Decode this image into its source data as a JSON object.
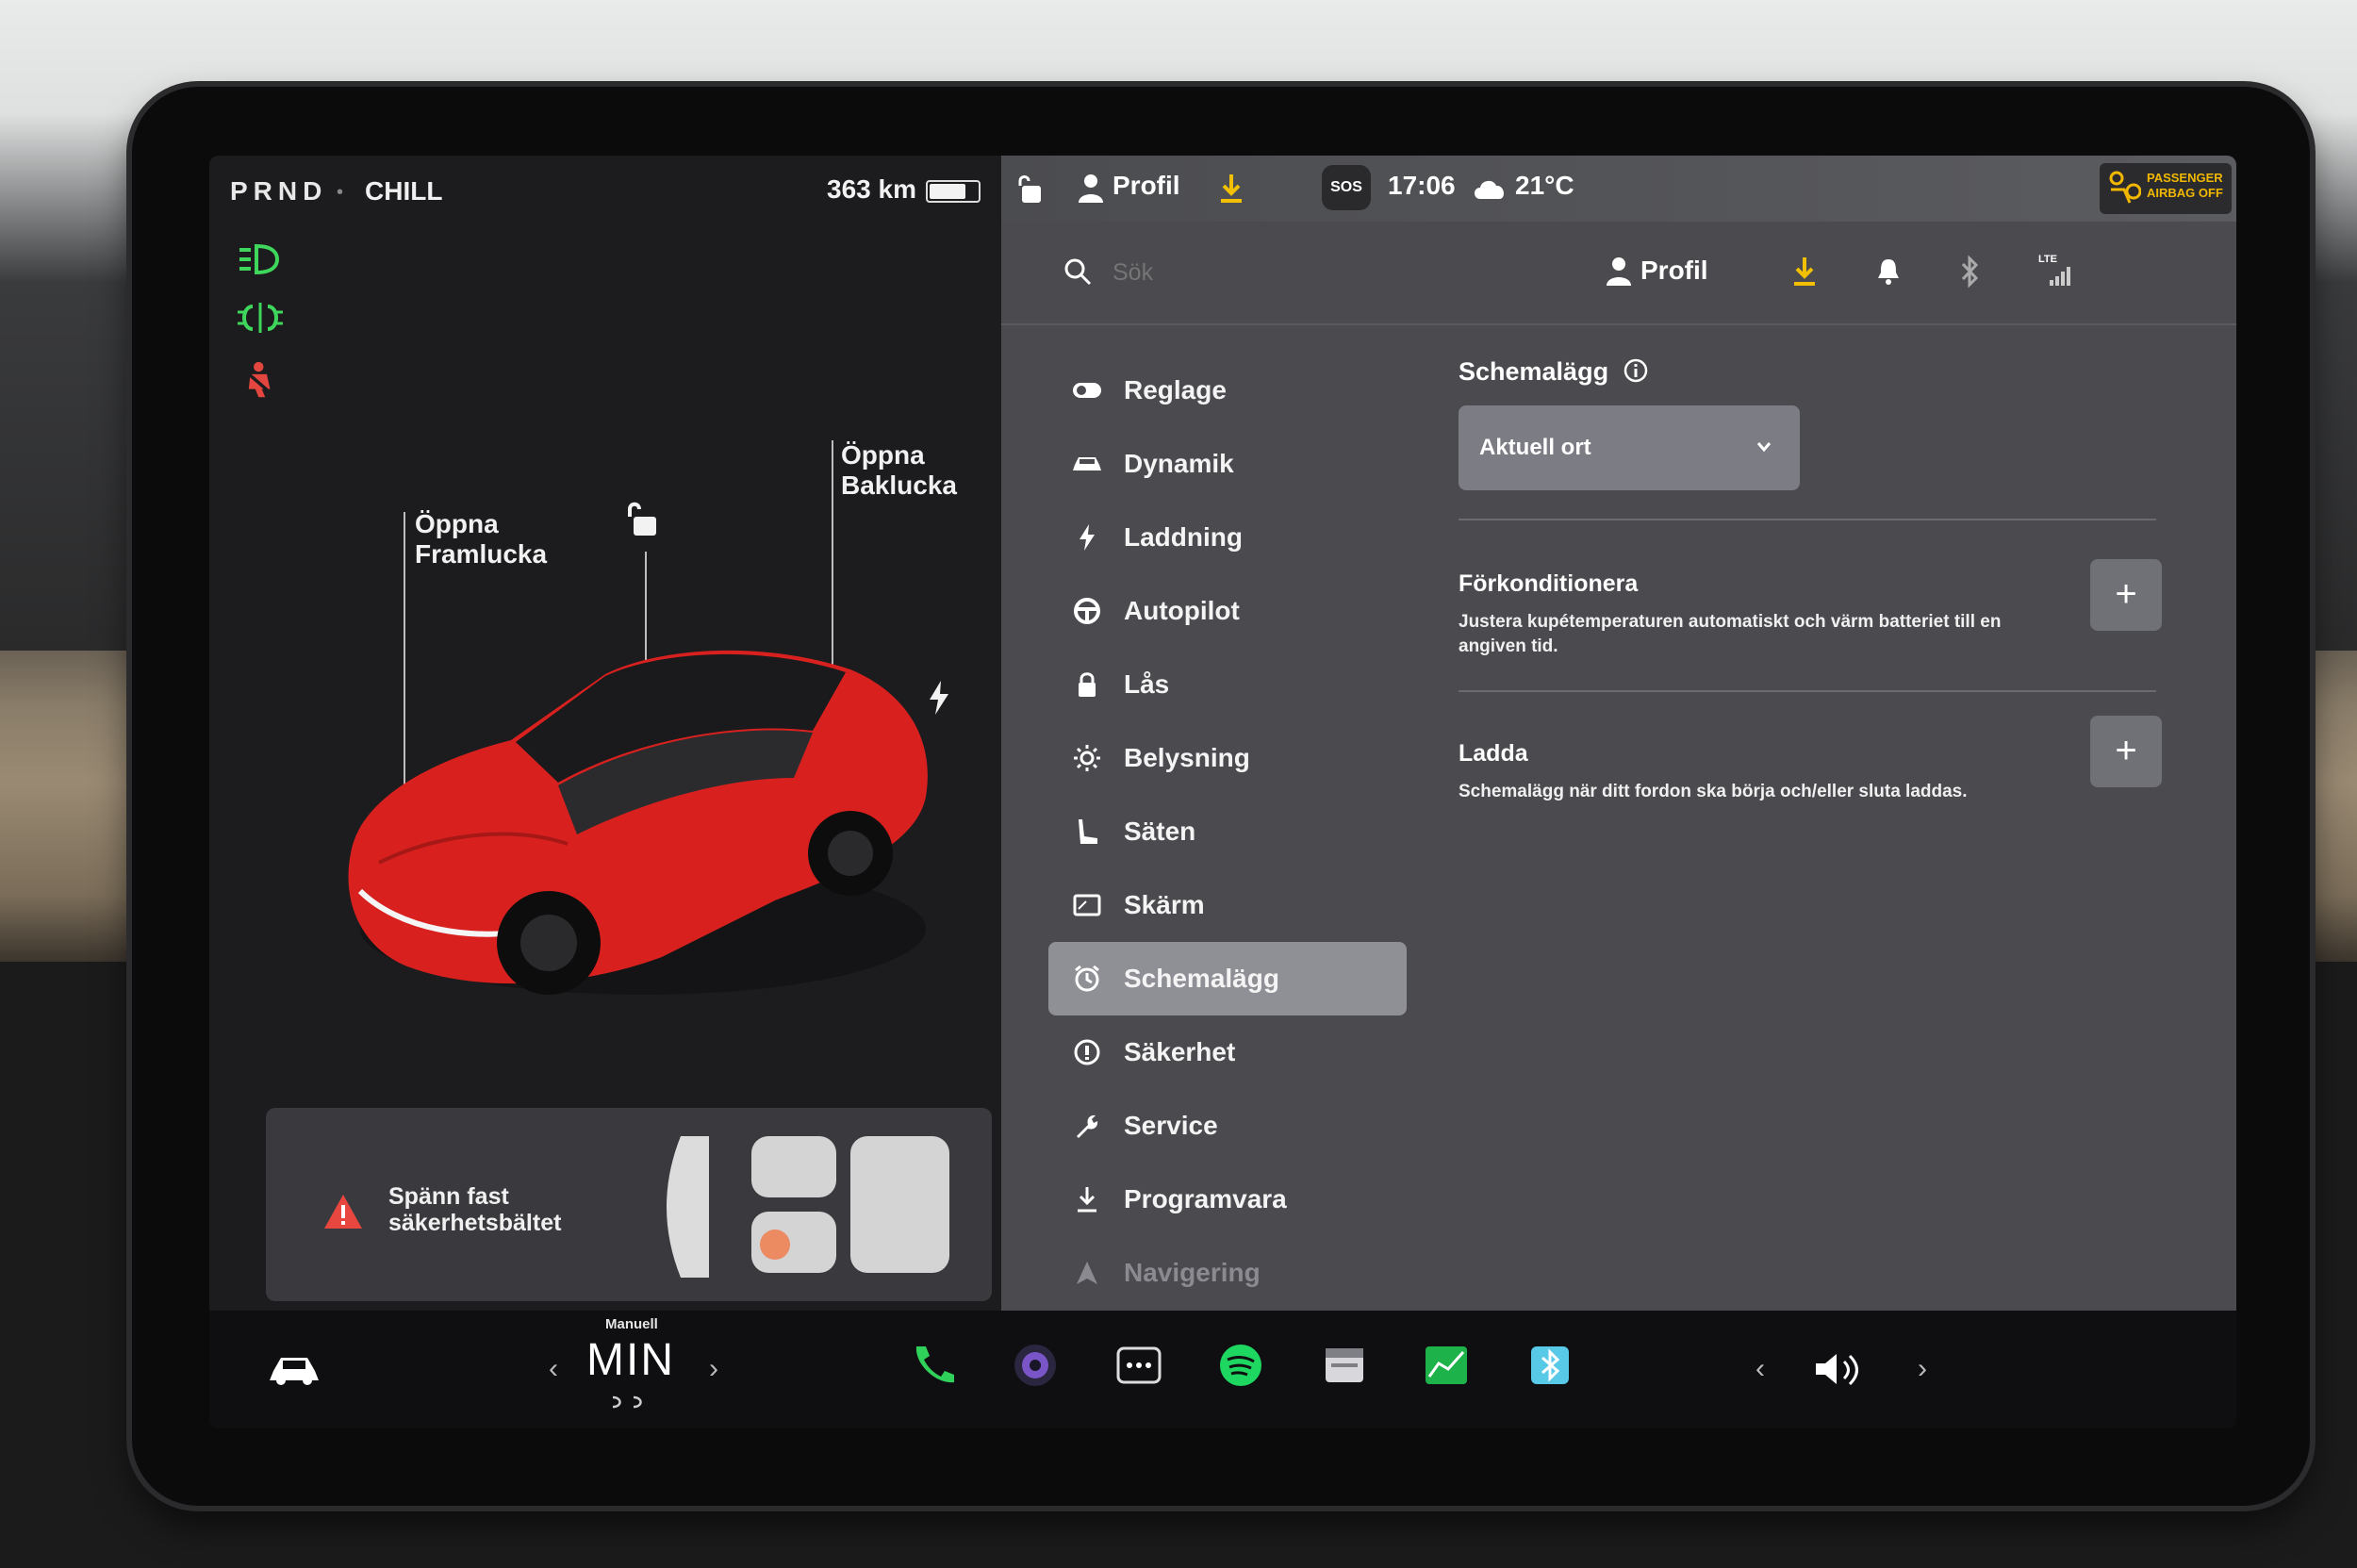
{
  "status_left": {
    "gear": "PRND",
    "drive_mode": "CHILL",
    "range": "363 km",
    "battery_level": 0.75
  },
  "car_view": {
    "frunk_label_line1": "Öppna",
    "frunk_label_line2": "Framlucka",
    "trunk_label_line1": "Öppna",
    "trunk_label_line2": "Baklucka",
    "car_color": "#d8211f"
  },
  "alert": {
    "line1": "Spänn fast",
    "line2": "säkerhetsbältet"
  },
  "top_strip": {
    "profile": "Profil",
    "sos": "SOS",
    "time": "17:06",
    "temperature": "21°C",
    "airbag_line1": "PASSENGER",
    "airbag_line2": "AIRBAG OFF"
  },
  "settings": {
    "search_placeholder": "Sök",
    "profile": "Profil",
    "network": "LTE",
    "menu": [
      {
        "label": "Reglage",
        "icon": "toggle-icon"
      },
      {
        "label": "Dynamik",
        "icon": "car-icon"
      },
      {
        "label": "Laddning",
        "icon": "bolt-icon"
      },
      {
        "label": "Autopilot",
        "icon": "steering-wheel-icon"
      },
      {
        "label": "Lås",
        "icon": "lock-icon"
      },
      {
        "label": "Belysning",
        "icon": "sun-icon"
      },
      {
        "label": "Säten",
        "icon": "seat-icon"
      },
      {
        "label": "Skärm",
        "icon": "display-icon"
      },
      {
        "label": "Schemalägg",
        "icon": "clock-icon"
      },
      {
        "label": "Säkerhet",
        "icon": "warning-icon"
      },
      {
        "label": "Service",
        "icon": "wrench-icon"
      },
      {
        "label": "Programvara",
        "icon": "download-icon"
      },
      {
        "label": "Navigering",
        "icon": "navigation-icon"
      }
    ],
    "active_item": "Schemalägg",
    "content": {
      "title": "Schemalägg",
      "dropdown_value": "Aktuell ort",
      "precondition_title": "Förkonditionera",
      "precondition_desc": "Justera kupétemperaturen automatiskt och värm batteriet till en angiven tid.",
      "charge_title": "Ladda",
      "charge_desc": "Schemalägg när ditt fordon ska börja och/eller sluta laddas.",
      "plus": "+"
    }
  },
  "dock": {
    "climate_mode": "Manuell",
    "climate_value": "MIN",
    "accent_green": "#2fd15b",
    "accent_spotify": "#1ed760"
  }
}
